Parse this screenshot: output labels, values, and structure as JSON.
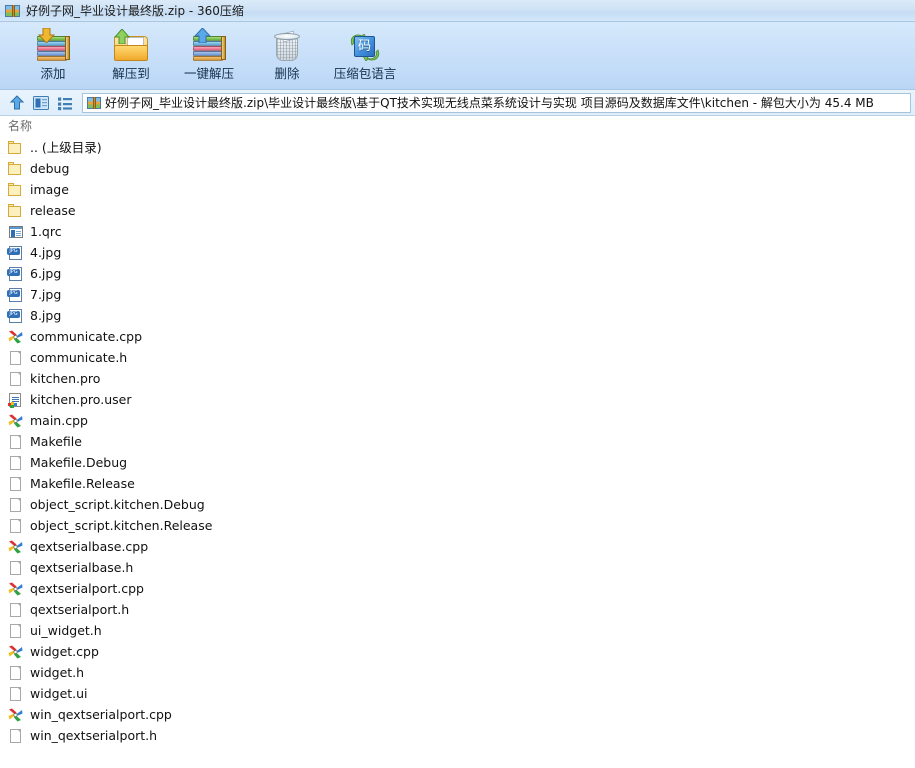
{
  "window": {
    "title": "好例子网_毕业设计最终版.zip - 360压缩",
    "icon": "archive-icon"
  },
  "toolbar": {
    "buttons": [
      {
        "label": "添加",
        "icon": "archive-add-icon"
      },
      {
        "label": "解压到",
        "icon": "folder-extract-icon"
      },
      {
        "label": "一键解压",
        "icon": "archive-extract-icon"
      },
      {
        "label": "删除",
        "icon": "trash-icon"
      },
      {
        "label": "压缩包语言",
        "icon": "language-icon"
      }
    ]
  },
  "navbar": {
    "icons": [
      {
        "name": "up-arrow-icon"
      },
      {
        "name": "preview-panel-icon"
      },
      {
        "name": "list-view-icon"
      }
    ],
    "address": {
      "icon": "archive-icon",
      "path": "好例子网_毕业设计最终版.zip\\毕业设计最终版\\基于QT技术实现无线点菜系统设计与实现 项目源码及数据库文件\\kitchen",
      "separator": " - ",
      "size_info": "解包大小为 45.4 MB",
      "full_text": "好例子网_毕业设计最终版.zip\\毕业设计最终版\\基于QT技术实现无线点菜系统设计与实现 项目源码及数据库文件\\kitchen - 解包大小为 45.4 MB"
    }
  },
  "filelist": {
    "columns": [
      "名称"
    ],
    "rows": [
      {
        "name": ".. (上级目录)",
        "icon": "folder-icon"
      },
      {
        "name": "debug",
        "icon": "folder-icon"
      },
      {
        "name": "image",
        "icon": "folder-icon"
      },
      {
        "name": "release",
        "icon": "folder-icon"
      },
      {
        "name": "1.qrc",
        "icon": "qrc-file-icon"
      },
      {
        "name": "4.jpg",
        "icon": "jpg-file-icon"
      },
      {
        "name": "6.jpg",
        "icon": "jpg-file-icon"
      },
      {
        "name": "7.jpg",
        "icon": "jpg-file-icon"
      },
      {
        "name": "8.jpg",
        "icon": "jpg-file-icon"
      },
      {
        "name": "communicate.cpp",
        "icon": "cpp-file-icon"
      },
      {
        "name": "communicate.h",
        "icon": "page-file-icon"
      },
      {
        "name": "kitchen.pro",
        "icon": "page-file-icon"
      },
      {
        "name": "kitchen.pro.user",
        "icon": "xml-file-icon"
      },
      {
        "name": "main.cpp",
        "icon": "cpp-file-icon"
      },
      {
        "name": "Makefile",
        "icon": "page-file-icon"
      },
      {
        "name": "Makefile.Debug",
        "icon": "page-file-icon"
      },
      {
        "name": "Makefile.Release",
        "icon": "page-file-icon"
      },
      {
        "name": "object_script.kitchen.Debug",
        "icon": "page-file-icon"
      },
      {
        "name": "object_script.kitchen.Release",
        "icon": "page-file-icon"
      },
      {
        "name": "qextserialbase.cpp",
        "icon": "cpp-file-icon"
      },
      {
        "name": "qextserialbase.h",
        "icon": "page-file-icon"
      },
      {
        "name": "qextserialport.cpp",
        "icon": "cpp-file-icon"
      },
      {
        "name": "qextserialport.h",
        "icon": "page-file-icon"
      },
      {
        "name": "ui_widget.h",
        "icon": "page-file-icon"
      },
      {
        "name": "widget.cpp",
        "icon": "cpp-file-icon"
      },
      {
        "name": "widget.h",
        "icon": "page-file-icon"
      },
      {
        "name": "widget.ui",
        "icon": "page-file-icon"
      },
      {
        "name": "win_qextserialport.cpp",
        "icon": "cpp-file-icon"
      },
      {
        "name": "win_qextserialport.h",
        "icon": "page-file-icon"
      }
    ]
  },
  "glyphs": {
    "lang_char": "码",
    "jpg_label": "JPG"
  },
  "colors": {
    "titlebar": "#cfe3f6",
    "toolbar_top": "#d6e9fb",
    "toolbar_bottom": "#bad6f6",
    "navbar": "#e4f0fb",
    "list_bg": "#ffffff",
    "text": "#111111",
    "header_text": "#6b6b6b"
  }
}
